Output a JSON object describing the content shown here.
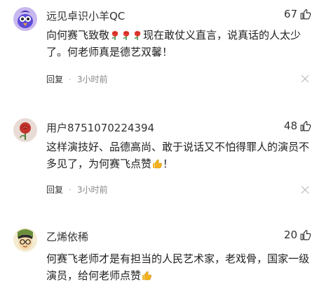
{
  "comments": [
    {
      "username": "远见卓识小羊QC",
      "likes": "67",
      "text_before": "向何赛飞致敬",
      "emoji": "rose-emoji",
      "text_after": "现在敢仗义直言，说真话的人太少了。何老师真是德艺双馨！",
      "reply_label": "回复",
      "time": "3小时前"
    },
    {
      "username": "用户8751070224394",
      "likes": "48",
      "text_before": "这样演技好、品德高尚、敢于说话又不怕得罪人的演员不多见了，为何赛飞点赞",
      "emoji": "thumbs-up-emoji",
      "text_after": "！",
      "reply_label": "回复",
      "time": "3小时前"
    },
    {
      "username": "乙烯依稀",
      "likes": "20",
      "text_before": "何赛飞老师才是有担当的人民艺术家，老戏骨，国家一级演员，给何老师点赞",
      "emoji": "thumbs-up-emoji",
      "text_after": ""
    }
  ],
  "separator": "·",
  "colors": {
    "text": "#222222",
    "meta": "#888888",
    "emoji_yellow": "#f5b21c",
    "rose_red": "#e03a2f"
  }
}
